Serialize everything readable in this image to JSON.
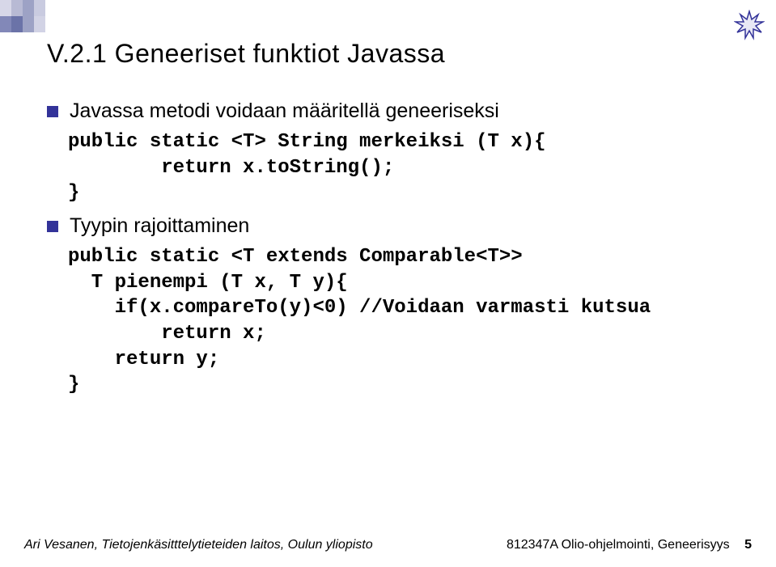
{
  "title": "V.2.1 Geneeriset funktiot Javassa",
  "bullets": {
    "b1": "Javassa metodi voidaan määritellä geneeriseksi",
    "b2": "Tyypin rajoittaminen"
  },
  "code": {
    "block1": "public static <T> String merkeiksi (T x){\n        return x.toString();\n}",
    "block2": "public static <T extends Comparable<T>>\n  T pienempi (T x, T y){\n    if(x.compareTo(y)<0) //Voidaan varmasti kutsua\n        return x;\n    return y;\n}"
  },
  "footer": {
    "left": "Ari Vesanen, Tietojenkäsitttelytieteiden laitos, Oulun yliopisto",
    "course": "812347A Olio-ohjelmointi, Geneerisyys",
    "page": "5"
  }
}
